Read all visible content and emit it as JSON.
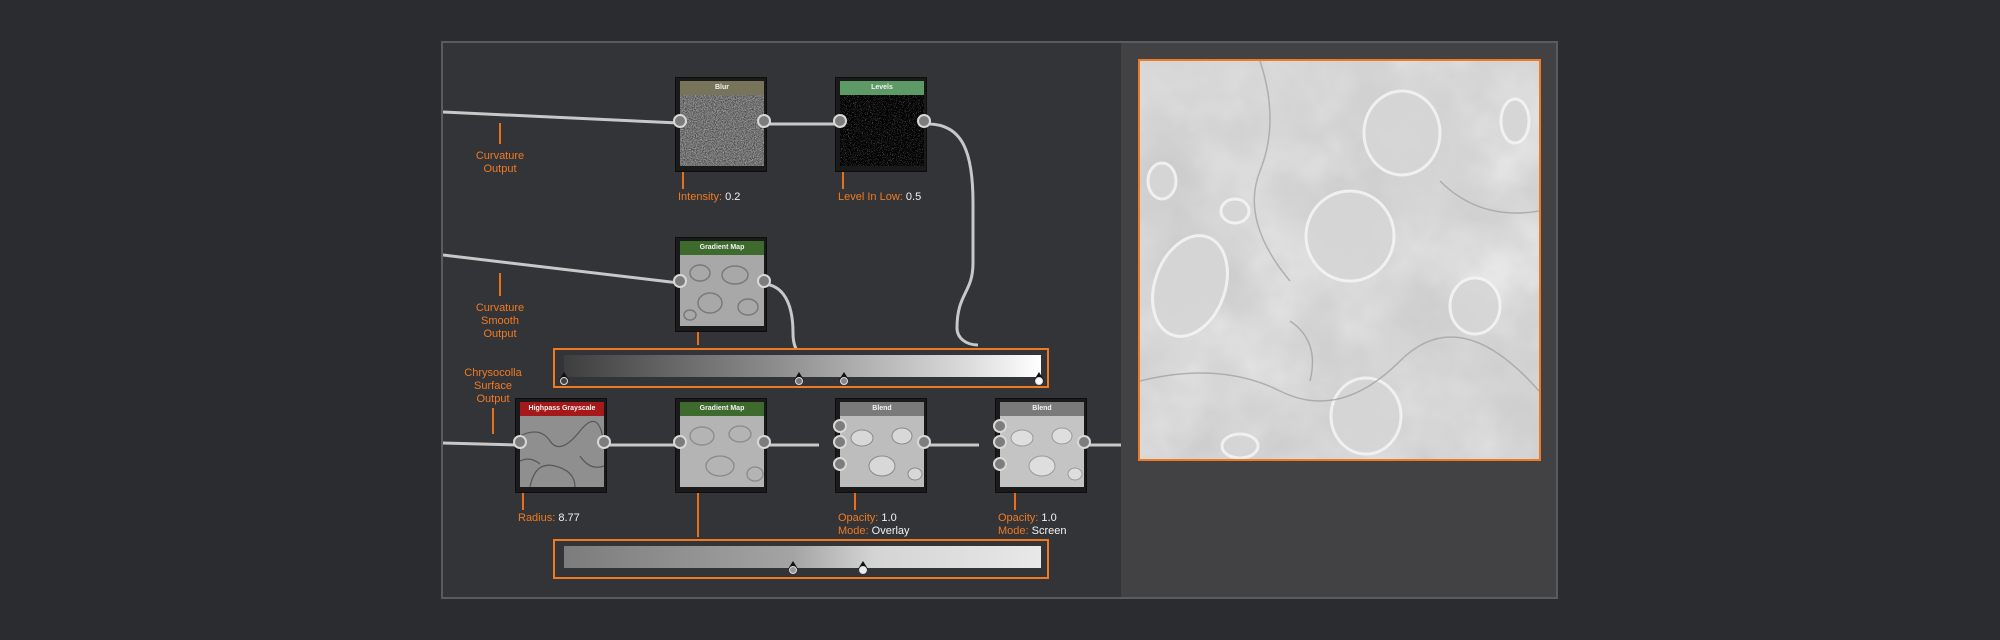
{
  "nodes": {
    "blur": {
      "title": "Blur",
      "param_label": "Intensity:",
      "param_value": "0.2",
      "color": "#77745a"
    },
    "levels": {
      "title": "Levels",
      "param_label": "Level In Low:",
      "param_value": "0.5",
      "color": "#5e9a66"
    },
    "gradient_map_top": {
      "title": "Gradient Map",
      "color": "#3f6a2e"
    },
    "highpass": {
      "title": "Highpass Grayscale",
      "param_label": "Radius:",
      "param_value": "8.77",
      "color": "#a6191b"
    },
    "gradient_map_bottom": {
      "title": "Gradient Map",
      "color": "#3f6a2e"
    },
    "blend_overlay": {
      "title": "Blend",
      "opacity_label": "Opacity:",
      "opacity_value": "1.0",
      "mode_label": "Mode:",
      "mode_value": "Overlay",
      "color": "#7a7a7a"
    },
    "blend_screen": {
      "title": "Blend",
      "opacity_label": "Opacity:",
      "opacity_value": "1.0",
      "mode_label": "Mode:",
      "mode_value": "Screen",
      "color": "#7a7a7a"
    }
  },
  "outputs": {
    "curvature": "Curvature\nOutput",
    "curvature_smooth": "Curvature\nSmooth\nOutput",
    "chrysocolla": "Chrysocolla\nSurface\nOutput"
  },
  "colors": {
    "accent": "#f07a22",
    "wire": "#c8c8c8",
    "background": "#2b2c2f",
    "panel": "#333438"
  }
}
